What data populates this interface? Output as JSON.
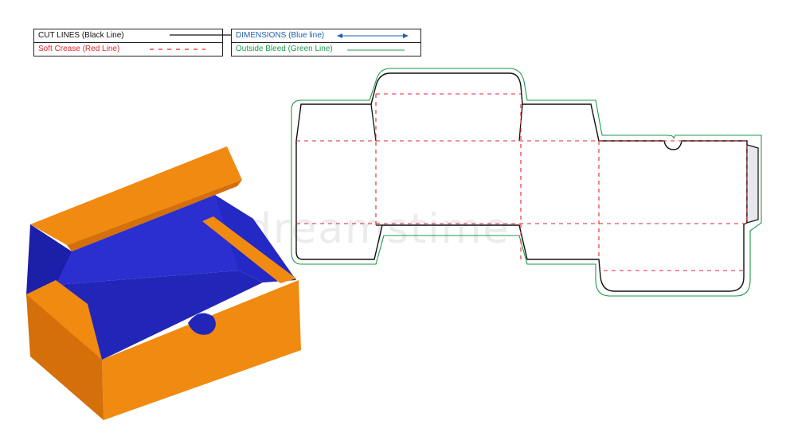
{
  "legend": {
    "cut_lines": "CUT LINES (Black Line)",
    "soft_crease": "Soft Crease (Red Line)",
    "dimensions": "DIMENSIONS (Blue line)",
    "outside_bleed": "Outside Bleed (Green Line)"
  },
  "watermark": "dreamstime",
  "colors": {
    "cut": "#111111",
    "crease": "#e0262b",
    "dimension": "#1f5fb0",
    "bleed": "#1e9a4a",
    "box_orange": "#f08a10",
    "box_orange_dark": "#d46f0a",
    "box_blue": "#2b2fd0",
    "box_blue_dark": "#1c1fa8"
  }
}
